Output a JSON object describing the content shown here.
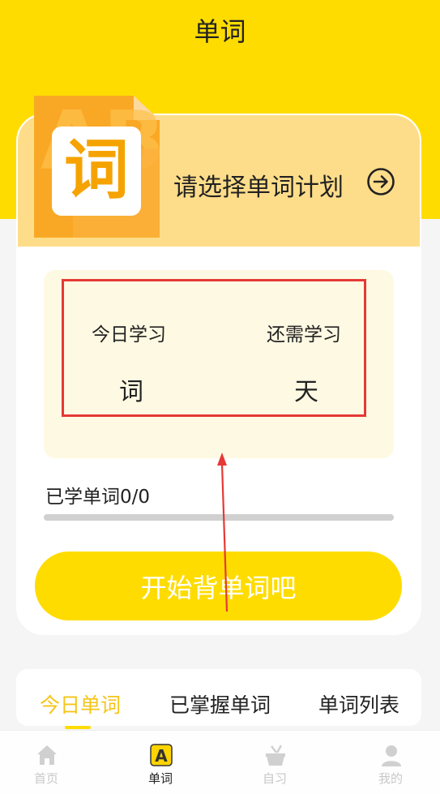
{
  "header": {
    "title": "单词"
  },
  "plan": {
    "prompt": "请选择单词计划",
    "logo_char": "词"
  },
  "stats": {
    "today_label": "今日学习",
    "today_value": "词",
    "remaining_label": "还需学习",
    "remaining_value": "天"
  },
  "progress": {
    "label": "已学单词0/0",
    "fraction": 0
  },
  "start_button": {
    "label": "开始背单词吧"
  },
  "tabs": [
    {
      "label": "今日单词",
      "active": true
    },
    {
      "label": "已掌握单词",
      "active": false
    },
    {
      "label": "单词列表",
      "active": false
    }
  ],
  "bottom_nav": [
    {
      "label": "首页",
      "icon": "home-icon",
      "active": false
    },
    {
      "label": "单词",
      "icon": "word-a-icon",
      "active": true
    },
    {
      "label": "自习",
      "icon": "study-desk-icon",
      "active": false
    },
    {
      "label": "我的",
      "icon": "profile-icon",
      "active": false
    }
  ],
  "colors": {
    "brand_yellow": "#FFDC00",
    "banner": "#FEDD8A",
    "stats_bg": "#FEF9E2",
    "annotation_red": "#E53935",
    "tab_active": "#F5C518",
    "nav_inactive": "#c8c8c8"
  }
}
